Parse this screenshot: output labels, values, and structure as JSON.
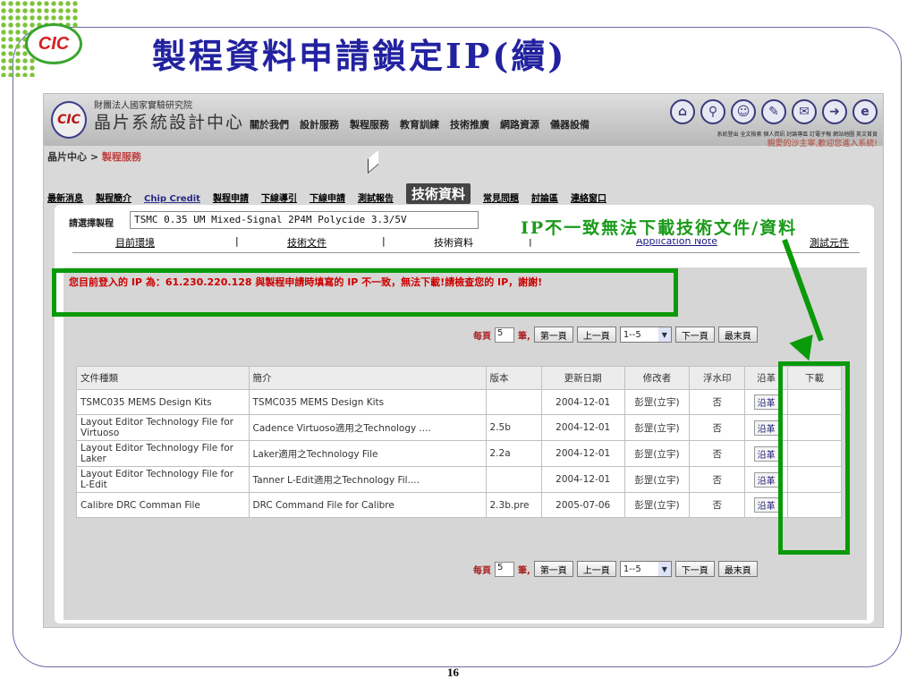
{
  "slide": {
    "title": "製程資料申請鎖定IP(續)",
    "logo": "CIC",
    "page_number": "16"
  },
  "header": {
    "org_name": "財團法人國家實驗研究院",
    "site_name": "晶片系統設計中心",
    "logo": "CIC",
    "nav": [
      "關於我們",
      "設計服務",
      "製程服務",
      "教育訓練",
      "技術推廣",
      "網路資源",
      "儀器設備"
    ],
    "icons": [
      "home-icon",
      "search-icon",
      "user-icon",
      "forum-icon",
      "mail-icon",
      "link-icon",
      "english-icon"
    ],
    "icon_labels": "系統登出 全文檢索 個人資訊 討論專區 訂電子報 網站地圖 英文首頁",
    "welcome": "親愛的沙主宰,歡迎您進入系統!"
  },
  "breadcrumb": {
    "home": "晶片中心",
    "sep": " > ",
    "current": "製程服務"
  },
  "tabs": [
    "最新消息",
    "製程簡介",
    "Chip Credit",
    "製程申請",
    "下線導引",
    "下線申請",
    "測試報告",
    "技術資料",
    "常見問題",
    "討論區",
    "連絡窗口"
  ],
  "active_tab_index": 7,
  "process": {
    "label": "請選擇製程",
    "value": "TSMC 0.35 UM Mixed-Signal 2P4M Polycide 3.3/5V"
  },
  "subnav": {
    "env": "目前環境",
    "docs": "技術文件",
    "data": "技術資料",
    "sep": "|",
    "app_note": "Application Note",
    "test": "測試元件"
  },
  "error_message": "您目前登入的 IP 為：61.230.220.128 與製程申請時填寫的 IP 不一致，無法下載!請檢查您的 IP，謝謝!",
  "pager": {
    "per_page_label": "每頁",
    "per_page": "5",
    "unit": "筆,",
    "first": "第一頁",
    "prev": "上一頁",
    "range": "1--5",
    "next": "下一頁",
    "last": "最末頁"
  },
  "table": {
    "headers": [
      "文件種類",
      "簡介",
      "版本",
      "更新日期",
      "修改者",
      "浮水印",
      "沿革",
      "下載"
    ],
    "rows": [
      [
        "TSMC035 MEMS Design Kits",
        "TSMC035 MEMS Design Kits",
        "",
        "2004-12-01",
        "彭罡(立宇)",
        "否",
        "沿革",
        ""
      ],
      [
        "Layout Editor Technology File for Virtuoso",
        "Cadence Virtuoso適用之Technology ....",
        "2.5b",
        "2004-12-01",
        "彭罡(立宇)",
        "否",
        "沿革",
        ""
      ],
      [
        "Layout Editor Technology File for Laker",
        "Laker適用之Technology File",
        "2.2a",
        "2004-12-01",
        "彭罡(立宇)",
        "否",
        "沿革",
        ""
      ],
      [
        "Layout Editor Technology File for L-Edit",
        "Tanner L-Edit適用之Technology Fil....",
        "",
        "2004-12-01",
        "彭罡(立宇)",
        "否",
        "沿革",
        ""
      ],
      [
        "Calibre DRC Comman File",
        "DRC Command File for Calibre",
        "2.3b.pre",
        "2005-07-06",
        "彭罡(立宇)",
        "否",
        "沿革",
        ""
      ]
    ]
  },
  "annotation": {
    "callout": "IP不一致無法下載技術文件/資料",
    "color": "#0a9a0a"
  }
}
